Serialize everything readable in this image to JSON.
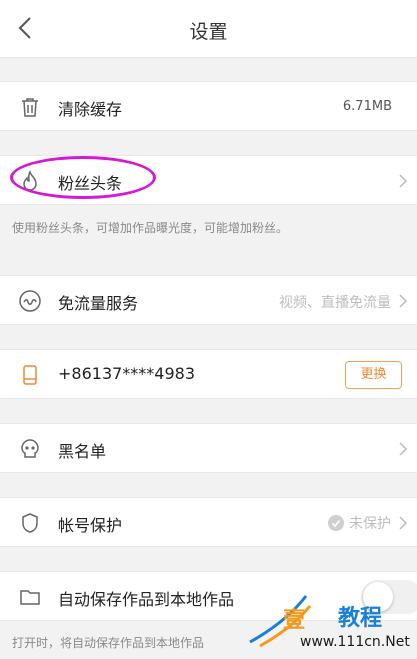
{
  "header": {
    "title": "设置"
  },
  "rows": {
    "clear_cache": {
      "label": "清除缓存",
      "value": "6.71MB"
    },
    "fans_headline": {
      "label": "粉丝头条"
    },
    "fans_hint": "使用粉丝头条，可增加作品曝光度，可能增加粉丝。",
    "free_traffic": {
      "label": "免流量服务",
      "value": "视频、直播免流量"
    },
    "phone": {
      "label": "+86137****4983",
      "button": "更换"
    },
    "blacklist": {
      "label": "黑名单"
    },
    "account_protect": {
      "label": "帐号保护",
      "value": "未保护"
    },
    "auto_save": {
      "label": "自动保存作品到本地作品",
      "toggle_on": false
    },
    "auto_save_hint": "打开时，将自动保存作品到本地作品"
  },
  "watermark": {
    "brand_part1": "壹",
    "brand_part2": "教程",
    "url": "www.111cn.Net"
  },
  "colors": {
    "accent": "#f08a30",
    "highlight": "#d21bd2",
    "background": "#f2f2f2"
  }
}
